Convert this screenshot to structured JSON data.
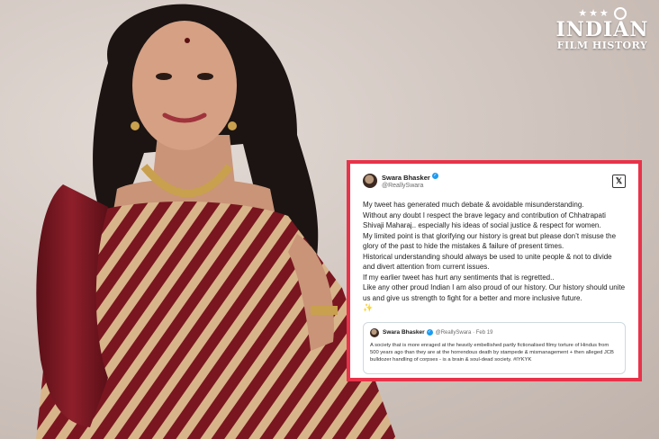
{
  "logo": {
    "stars": "★★★",
    "line1": "INDIAN",
    "line2": "FILM HISTORY"
  },
  "tweet": {
    "name": "Swara Bhasker",
    "handle": "@ReallySwara",
    "verified_icon": "verified-badge-icon",
    "action_icon": "x-logo-icon",
    "paragraphs": [
      "My tweet has generated much debate & avoidable misunderstanding.",
      "Without any doubt I respect the brave legacy and contribution of Chhatrapati Shivaji Maharaj.. especially his ideas of social justice & respect for women.",
      "My limited point is that glorifying our  history is great but please don’t misuse the glory of the past to hide the mistakes & failure of present times.",
      "Historical understanding should always be used to unite people & not to divide and divert attention from current issues.",
      "If my earlier  tweet has hurt any sentiments that is regretted..",
      "Like any other proud Indian I am also  proud of our history. Our history should unite us and give us strength to fight for a better and more inclusive future."
    ],
    "sparkle": "✨",
    "quote": {
      "name": "Swara Bhasker",
      "handle_date": "@ReallySwara · Feb 19",
      "text": "A society that is more enraged at the heavily embellished partly fictionalised filmy torture of Hindus from 500 years ago than they are at the horrendous death by stampede & mismanagement + then alleged JCB bulldozer handling of corpses - is a brain & soul-dead society. #IYKYK"
    }
  },
  "colors": {
    "frame": "#e8334a",
    "saree_maroon": "#7a1620",
    "saree_gold": "#d8b48a",
    "verified": "#1d9bf0"
  }
}
